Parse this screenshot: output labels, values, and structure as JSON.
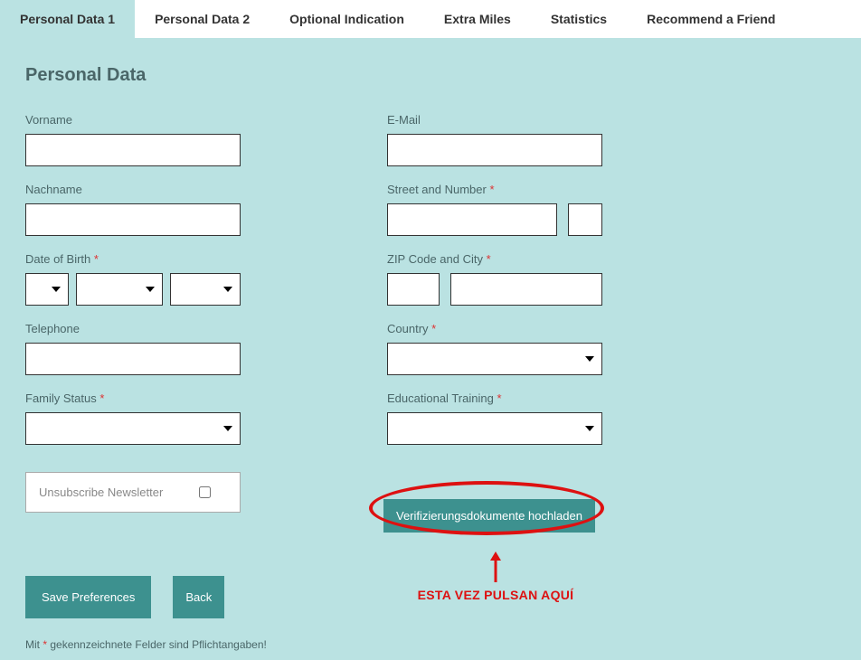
{
  "tabs": [
    {
      "label": "Personal Data 1",
      "active": true
    },
    {
      "label": "Personal Data 2",
      "active": false
    },
    {
      "label": "Optional Indication",
      "active": false
    },
    {
      "label": "Extra Miles",
      "active": false
    },
    {
      "label": "Statistics",
      "active": false
    },
    {
      "label": "Recommend a Friend",
      "active": false
    }
  ],
  "section_title": "Personal Data",
  "left": {
    "vorname_label": "Vorname",
    "nachname_label": "Nachname",
    "dob_label": "Date of Birth",
    "telephone_label": "Telephone",
    "family_status_label": "Family Status",
    "newsletter_label": "Unsubscribe Newsletter"
  },
  "right": {
    "email_label": "E-Mail",
    "street_label": "Street and Number",
    "zip_label": "ZIP Code and City",
    "country_label": "Country",
    "education_label": "Educational Training",
    "upload_label": "Verifizierungsdokumente hochladen"
  },
  "annotation": {
    "text": "ESTA VEZ PULSAN AQUÍ"
  },
  "actions": {
    "save": "Save Preferences",
    "back": "Back"
  },
  "footnote": {
    "prefix": "Mit ",
    "star": "*",
    "suffix": " gekennzeichnete Felder sind Pflichtangaben!"
  }
}
